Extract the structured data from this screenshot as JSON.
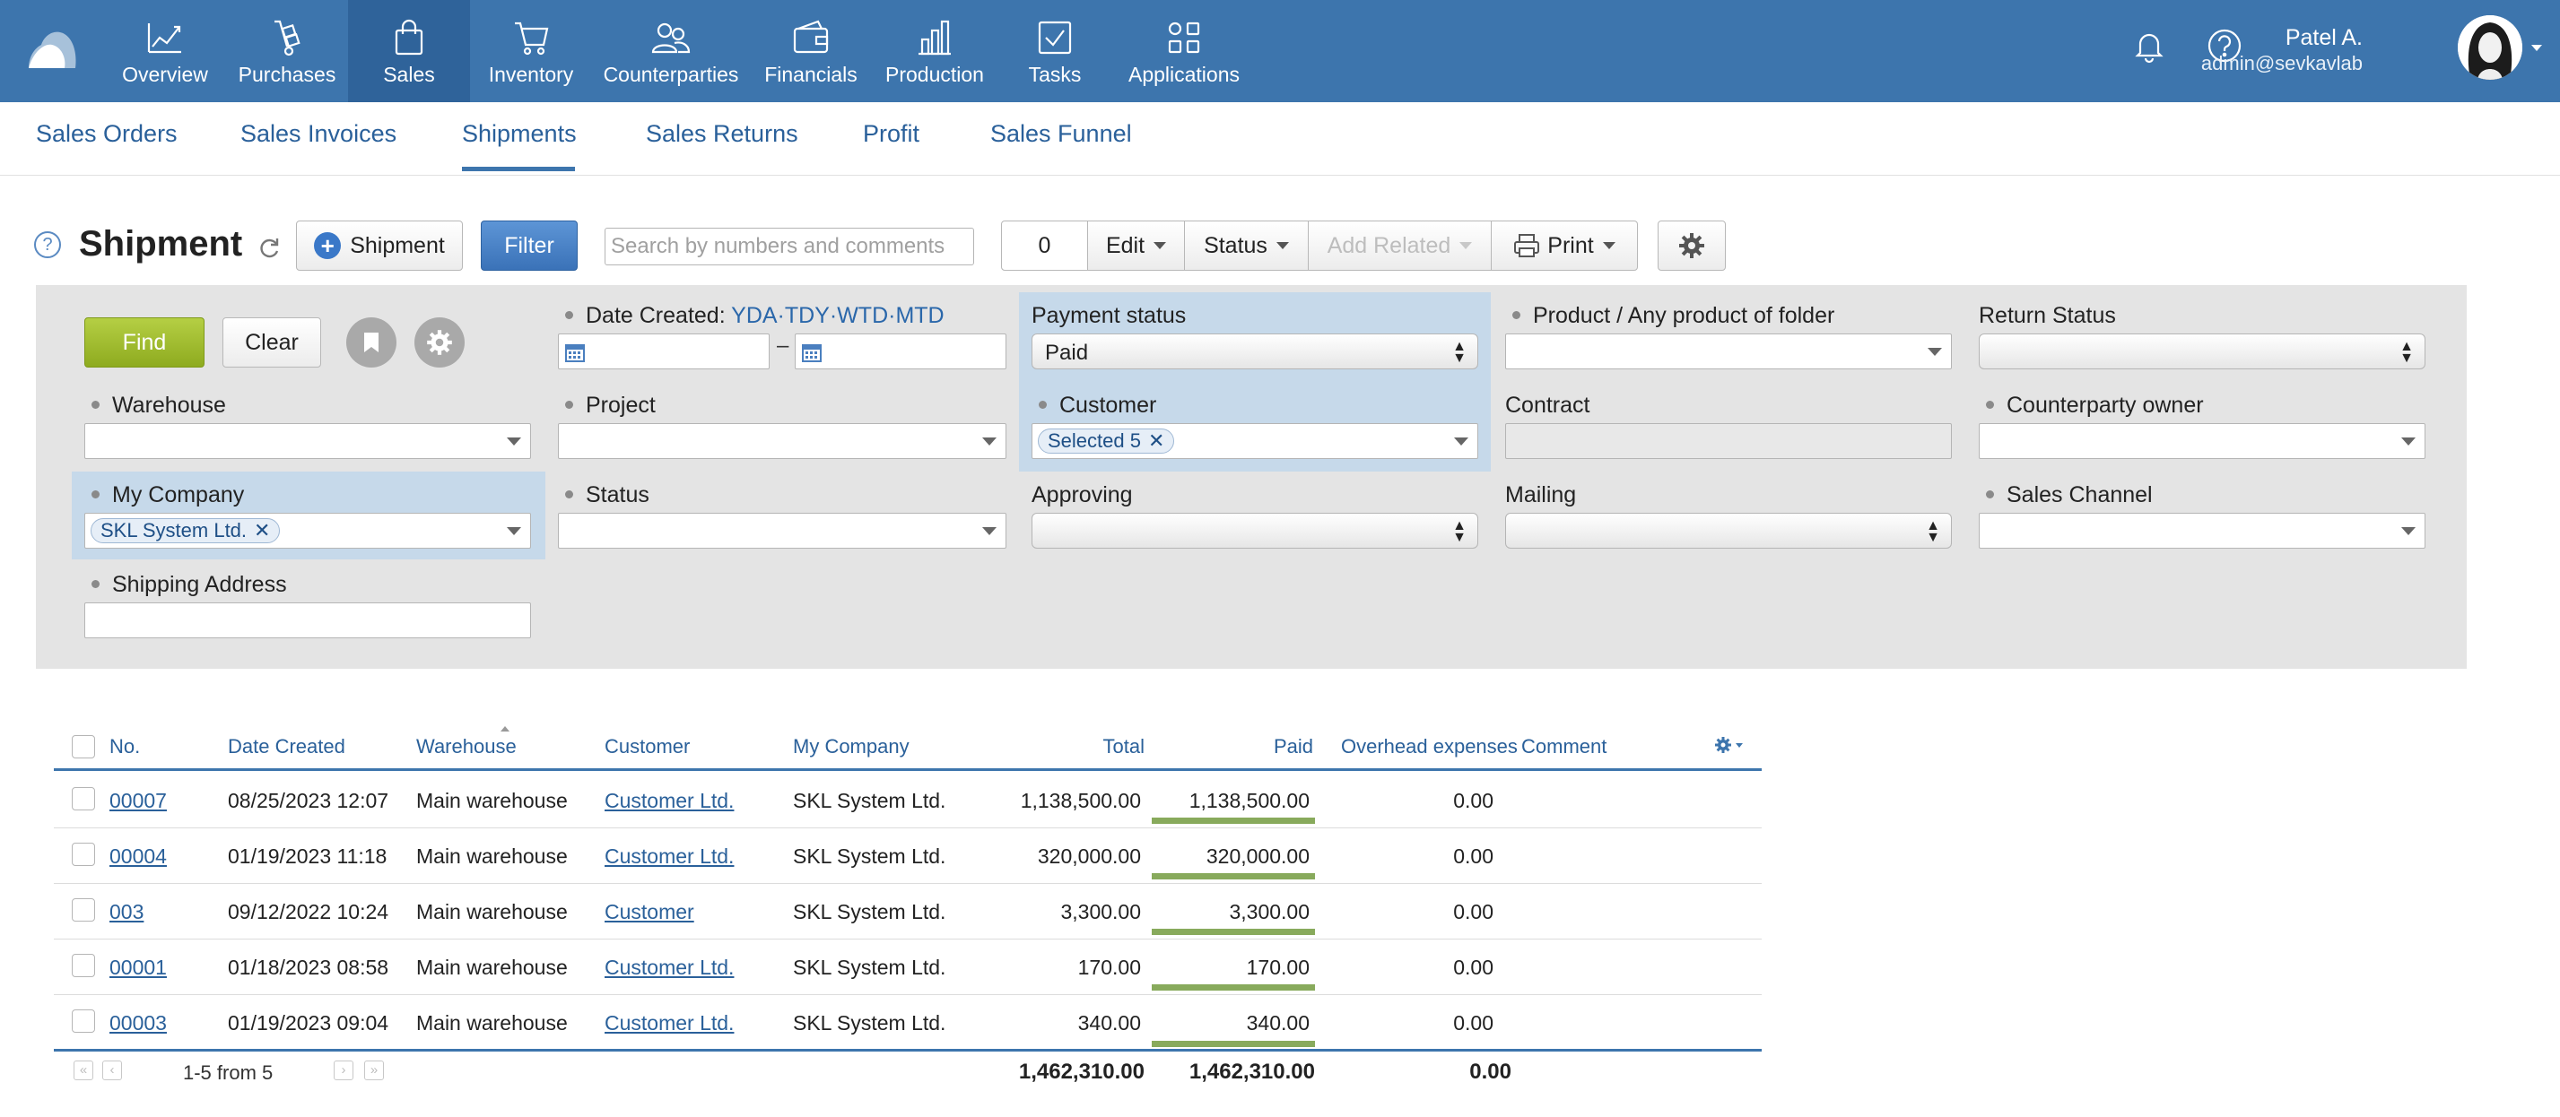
{
  "nav": {
    "items": [
      {
        "label": "Overview",
        "icon": "chart-line-icon"
      },
      {
        "label": "Purchases",
        "icon": "hand-truck-icon"
      },
      {
        "label": "Sales",
        "icon": "shopping-bag-icon"
      },
      {
        "label": "Inventory",
        "icon": "cart-icon"
      },
      {
        "label": "Counterparties",
        "icon": "people-icon"
      },
      {
        "label": "Financials",
        "icon": "wallet-icon"
      },
      {
        "label": "Production",
        "icon": "factory-icon"
      },
      {
        "label": "Tasks",
        "icon": "checkbox-icon"
      },
      {
        "label": "Applications",
        "icon": "apps-grid-icon"
      }
    ],
    "active": "Sales"
  },
  "user": {
    "name": "Patel A.",
    "email": "admin@sevkavlab"
  },
  "subtabs": [
    "Sales Orders",
    "Sales Invoices",
    "Shipments",
    "Sales Returns",
    "Profit",
    "Sales Funnel"
  ],
  "subtab_active": "Shipments",
  "toolbar": {
    "help": "?",
    "title": "Shipment",
    "add_label": "Shipment",
    "filter_label": "Filter",
    "search_placeholder": "Search by numbers and comments",
    "selected_count": "0",
    "edit_label": "Edit",
    "status_label": "Status",
    "add_related_label": "Add Related",
    "print_label": "Print"
  },
  "filters": {
    "find_label": "Find",
    "clear_label": "Clear",
    "date_created_label": "Date Created:",
    "date_shortcuts": [
      "YDA",
      "TDY",
      "WTD",
      "MTD"
    ],
    "payment_status_label": "Payment status",
    "payment_status_value": "Paid",
    "product_label": "Product / Any product of folder",
    "return_status_label": "Return Status",
    "warehouse_label": "Warehouse",
    "project_label": "Project",
    "customer_label": "Customer",
    "customer_chip": "Selected 5",
    "contract_label": "Contract",
    "counterparty_owner_label": "Counterparty owner",
    "my_company_label": "My Company",
    "my_company_chip": "SKL System Ltd.",
    "status_label": "Status",
    "approving_label": "Approving",
    "mailing_label": "Mailing",
    "sales_channel_label": "Sales Channel",
    "shipping_address_label": "Shipping Address"
  },
  "table": {
    "columns": {
      "no": "No.",
      "date": "Date Created",
      "warehouse": "Warehouse",
      "customer": "Customer",
      "company": "My Company",
      "total": "Total",
      "paid": "Paid",
      "overhead": "Overhead expenses",
      "comment": "Comment"
    },
    "rows": [
      {
        "no": "00007",
        "date": "08/25/2023 12:07",
        "warehouse": "Main warehouse",
        "customer": "Customer Ltd.",
        "company": "SKL System Ltd.",
        "total": "1,138,500.00",
        "paid": "1,138,500.00",
        "paid_fraction": 1,
        "overhead": "0.00",
        "comment": ""
      },
      {
        "no": "00004",
        "date": "01/19/2023 11:18",
        "warehouse": "Main warehouse",
        "customer": "Customer Ltd.",
        "company": "SKL System Ltd.",
        "total": "320,000.00",
        "paid": "320,000.00",
        "paid_fraction": 1,
        "overhead": "0.00",
        "comment": ""
      },
      {
        "no": "003",
        "date": "09/12/2022 10:24",
        "warehouse": "Main warehouse",
        "customer": "Customer",
        "company": "SKL System Ltd.",
        "total": "3,300.00",
        "paid": "3,300.00",
        "paid_fraction": 1,
        "overhead": "0.00",
        "comment": ""
      },
      {
        "no": "00001",
        "date": "01/18/2023 08:58",
        "warehouse": "Main warehouse",
        "customer": "Customer Ltd.",
        "company": "SKL System Ltd.",
        "total": "170.00",
        "paid": "170.00",
        "paid_fraction": 1,
        "overhead": "0.00",
        "comment": ""
      },
      {
        "no": "00003",
        "date": "01/19/2023 09:04",
        "warehouse": "Main warehouse",
        "customer": "Customer Ltd.",
        "company": "SKL System Ltd.",
        "total": "340.00",
        "paid": "340.00",
        "paid_fraction": 1,
        "overhead": "0.00",
        "comment": ""
      }
    ],
    "pager_text": "1-5 from 5",
    "pager_first": "«",
    "pager_prev": "‹",
    "pager_next": "›",
    "pager_last": "»",
    "totals": {
      "total": "1,462,310.00",
      "paid": "1,462,310.00",
      "overhead": "0.00"
    }
  },
  "colors": {
    "topbar": "#3d75ad",
    "active_nav": "#2f639a",
    "link": "#2a609a",
    "find_button": "#9dbb2b",
    "paid_bar": "#88aa5c",
    "filter_highlight": "#c6d9ea"
  }
}
